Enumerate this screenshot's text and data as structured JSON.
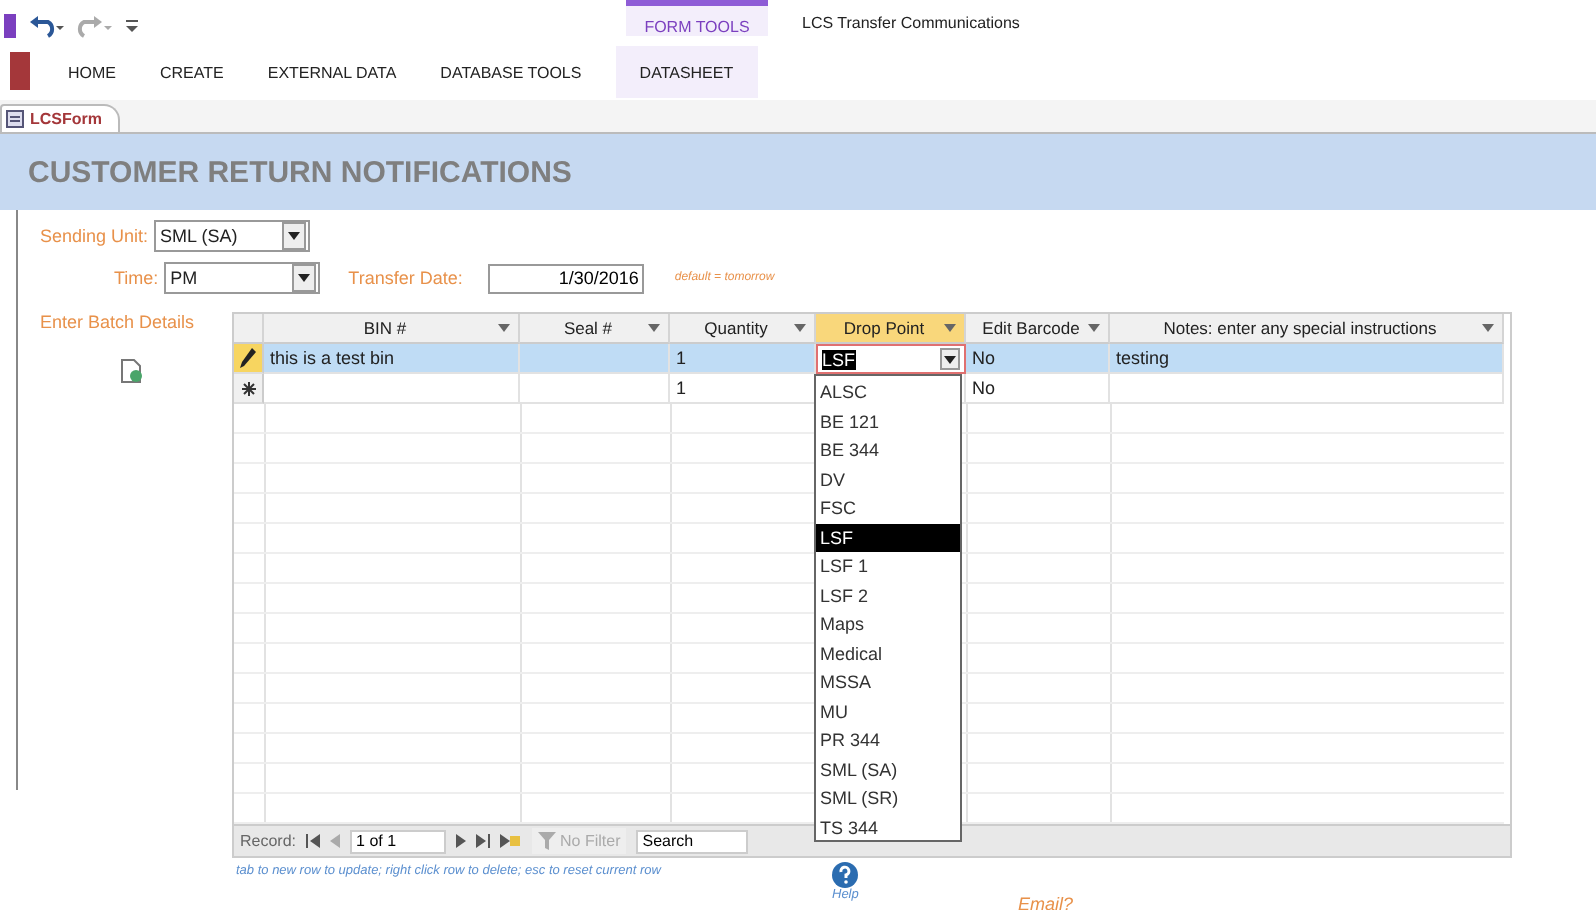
{
  "ribbon": {
    "context_group": "FORM TOOLS",
    "title": "LCS Transfer Communications",
    "tabs": [
      {
        "label": "HOME",
        "selected": false
      },
      {
        "label": "CREATE",
        "selected": false
      },
      {
        "label": "EXTERNAL DATA",
        "selected": false
      },
      {
        "label": "DATABASE TOOLS",
        "selected": false
      },
      {
        "label": "DATASHEET",
        "selected": true
      }
    ]
  },
  "document_tab": "LCSForm",
  "form": {
    "heading": "CUSTOMER RETURN NOTIFICATIONS",
    "sending_unit": {
      "label": "Sending Unit:",
      "value": "SML (SA)"
    },
    "time": {
      "label": "Time:",
      "value": "PM"
    },
    "transfer_date": {
      "label": "Transfer Date:",
      "value": "1/30/2016",
      "note": "default = tomorrow"
    },
    "batch_label": "Enter Batch Details",
    "table": {
      "columns": [
        {
          "label": "BIN #",
          "highlighted": false
        },
        {
          "label": "Seal #",
          "highlighted": false
        },
        {
          "label": "Quantity",
          "highlighted": false
        },
        {
          "label": "Drop Point",
          "highlighted": true
        },
        {
          "label": "Edit Barcode",
          "highlighted": false
        },
        {
          "label": "Notes: enter any special instructions",
          "highlighted": false
        }
      ],
      "rows": [
        {
          "kind": "edit",
          "selected": true,
          "cells": [
            "this is a test bin",
            "",
            "1",
            "LSF",
            "No",
            "testing"
          ]
        },
        {
          "kind": "new",
          "selected": false,
          "cells": [
            "",
            "",
            "1",
            "",
            "No",
            ""
          ]
        }
      ]
    },
    "dropdown": [
      {
        "label": "ALSC",
        "selected": false
      },
      {
        "label": "BE 121",
        "selected": false
      },
      {
        "label": "BE 344",
        "selected": false
      },
      {
        "label": "DV",
        "selected": false
      },
      {
        "label": "FSC",
        "selected": false
      },
      {
        "label": "LSF",
        "selected": true
      },
      {
        "label": "LSF 1",
        "selected": false
      },
      {
        "label": "LSF 2",
        "selected": false
      },
      {
        "label": "Maps",
        "selected": false
      },
      {
        "label": "Medical",
        "selected": false
      },
      {
        "label": "MSSA",
        "selected": false
      },
      {
        "label": "MU",
        "selected": false
      },
      {
        "label": "PR 344",
        "selected": false
      },
      {
        "label": "SML (SA)",
        "selected": false
      },
      {
        "label": "SML (SR)",
        "selected": false
      },
      {
        "label": "TS 344",
        "selected": false
      }
    ],
    "navigator": {
      "label": "Record:",
      "position": "1 of 1",
      "filter": "No Filter",
      "search": "Search"
    },
    "hint": "tab to new row to update; right click row to delete; esc to reset current row",
    "help": "Help",
    "email": "Email?"
  }
}
